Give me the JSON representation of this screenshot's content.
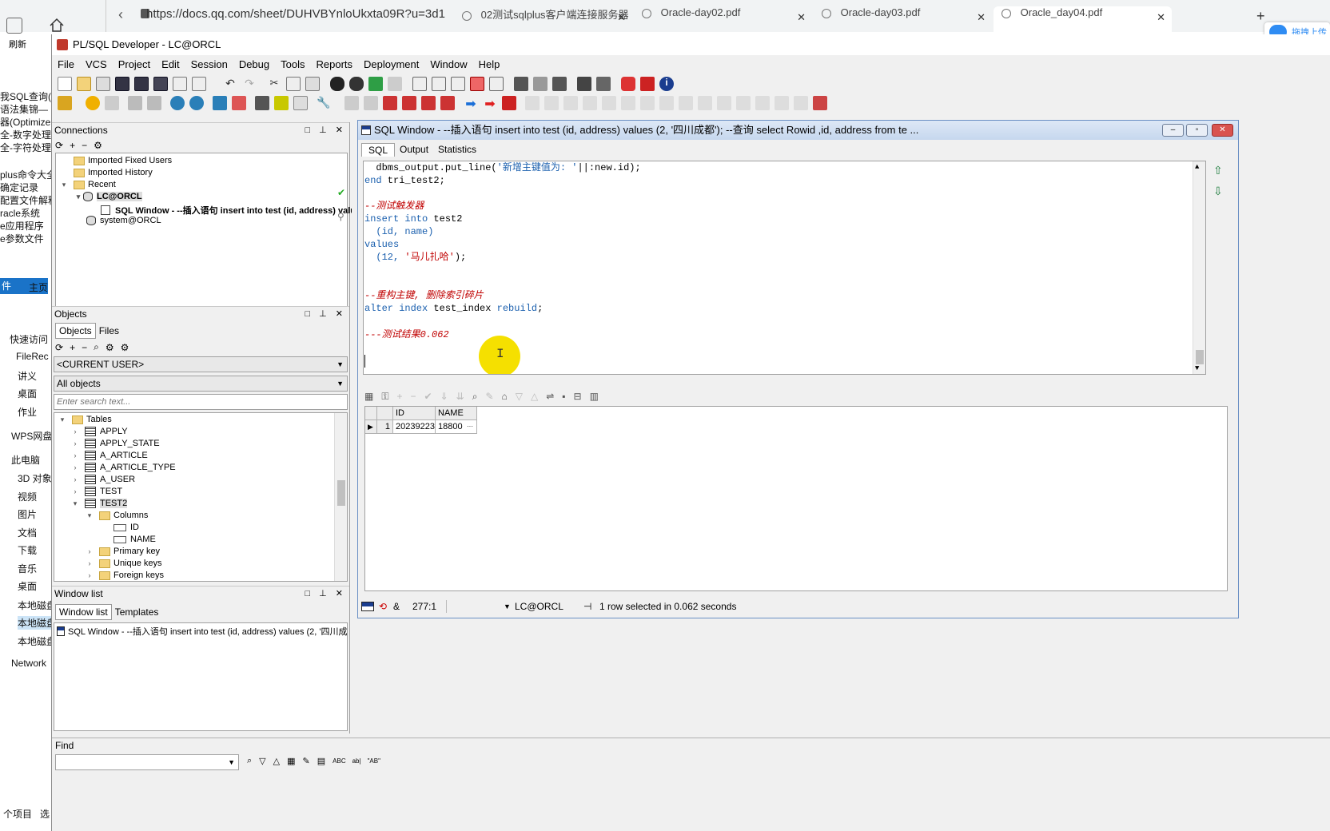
{
  "browser": {
    "refresh_label": "刷新",
    "url": "https://docs.qq.com/sheet/DUHVBYnloUkxta09R?u=3d1",
    "tabs": [
      {
        "label": "02测试sqlplus客户端连接服务器"
      },
      {
        "label": "Oracle-day02.pdf"
      },
      {
        "label": "Oracle-day03.pdf"
      },
      {
        "label": "Oracle_day04.pdf"
      }
    ],
    "upload_badge": "拖拽上传"
  },
  "explorer": {
    "items": [
      "我SQL查询(",
      "语法集锦—",
      "器(Optimize",
      "全-数字处理",
      "全-字符处理",
      "plus命令大全",
      "确定记录",
      "配置文件解释",
      "racle系统",
      "e应用程序",
      "e参数文件",
      "件",
      "主页",
      "快速访问",
      "FileRec",
      "讲义",
      "桌面",
      "作业",
      "WPS网盘",
      "此电脑",
      "3D 对象",
      "视频",
      "图片",
      "文档",
      "下载",
      "音乐",
      "桌面",
      "本地磁盘",
      "本地磁盘",
      "本地磁盘",
      "Network",
      "个项目",
      "选"
    ]
  },
  "app": {
    "title": "PL/SQL Developer - LC@ORCL",
    "menu": [
      "File",
      "VCS",
      "Project",
      "Edit",
      "Session",
      "Debug",
      "Tools",
      "Reports",
      "Deployment",
      "Window",
      "Help"
    ]
  },
  "connections": {
    "header": "Connections",
    "tree": [
      {
        "label": "Imported Fixed Users"
      },
      {
        "label": "Imported History"
      },
      {
        "label": "Recent"
      },
      {
        "label": "LC@ORCL"
      },
      {
        "label": "SQL Window - --插入语句 insert into test (id, address) valu"
      },
      {
        "label": "system@ORCL"
      }
    ]
  },
  "objects": {
    "header": "Objects",
    "tabs": [
      "Objects",
      "Files"
    ],
    "user_select": "<CURRENT USER>",
    "filter_select": "All objects",
    "search_placeholder": "Enter search text...",
    "tree": [
      {
        "label": "Tables"
      },
      {
        "label": "APPLY"
      },
      {
        "label": "APPLY_STATE"
      },
      {
        "label": "A_ARTICLE"
      },
      {
        "label": "A_ARTICLE_TYPE"
      },
      {
        "label": "A_USER"
      },
      {
        "label": "TEST"
      },
      {
        "label": "TEST2"
      },
      {
        "label": "Columns"
      },
      {
        "label": "ID"
      },
      {
        "label": "NAME"
      },
      {
        "label": "Primary key"
      },
      {
        "label": "Unique keys"
      },
      {
        "label": "Foreign keys"
      }
    ]
  },
  "window_list": {
    "header": "Window list",
    "tabs": [
      "Window list",
      "Templates"
    ],
    "item": "SQL Window - --插入语句 insert into test (id, address) values (2, '四川成"
  },
  "sql_window": {
    "title": "SQL Window - --插入语句 insert into test (id, address) values (2, '四川成都'); --查询 select Rowid ,id, address from te ...",
    "tabs": [
      "SQL",
      "Output",
      "Statistics"
    ],
    "code": {
      "l1_a": "  dbms_output.put_line(",
      "l1_b": "'新增主键值为: '",
      "l1_c": "||:new.id);",
      "l2_a": "end",
      "l2_b": " tri_test2;",
      "l3": "--测试触发器",
      "l4_a": "insert into",
      "l4_b": " test2",
      "l5": "  (id, name)",
      "l6": "values",
      "l7_a": "  (12, ",
      "l7_b": "'马儿扎哈'",
      "l7_c": ");",
      "l8": "--重构主键, 删除索引碎片",
      "l9_a": "alter index",
      "l9_b": " test_index ",
      "l9_c": "rebuild",
      "l9_d": ";",
      "l10": "---测试结果0.062"
    },
    "grid": {
      "columns": [
        "ID",
        "NAME"
      ],
      "rows": [
        {
          "num": "1",
          "id": "20239223",
          "name": "18800",
          "more": "···"
        }
      ]
    },
    "status": {
      "position": "277:1",
      "connection": "LC@ORCL",
      "message": "1 row selected in 0.062 seconds"
    }
  },
  "find": {
    "label": "Find"
  },
  "colors": {
    "title_blue": "#c6d7ee",
    "comment_red": "#c00000",
    "keyword_blue": "#1a5fae",
    "cursor_highlight": "#f5e000"
  }
}
